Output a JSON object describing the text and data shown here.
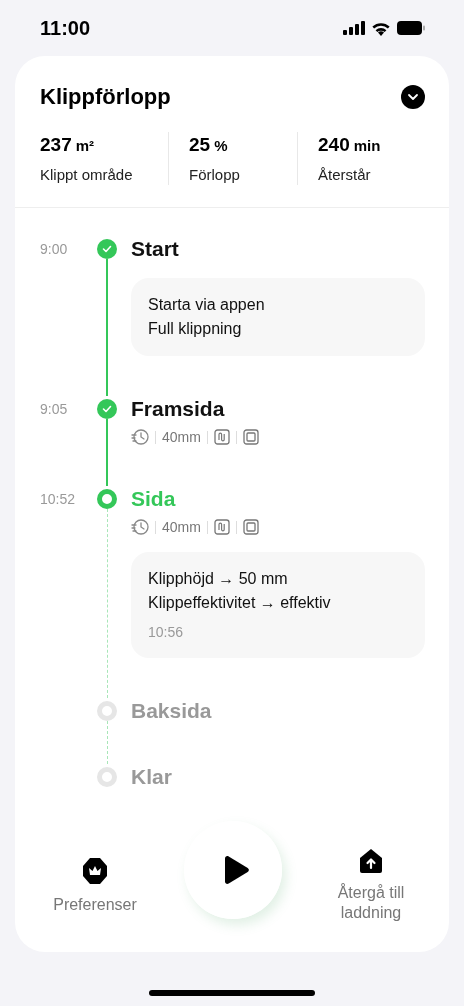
{
  "status_bar": {
    "time": "11:00"
  },
  "header": {
    "title": "Klippförlopp",
    "expanded": false
  },
  "stats": [
    {
      "value": "237",
      "unit": "m²",
      "label": "Klippt område"
    },
    {
      "value": "25",
      "unit": "%",
      "label": "Förlopp"
    },
    {
      "value": "240",
      "unit": "min",
      "label": "Återstår"
    }
  ],
  "steps": [
    {
      "time": "9:00",
      "title": "Start",
      "completed": true,
      "current": false,
      "note": {
        "lines": [
          "Starta via appen",
          "Full klippning"
        ]
      }
    },
    {
      "time": "9:05",
      "title": "Framsida",
      "completed": true,
      "current": false,
      "meta": {
        "height": "40mm"
      }
    },
    {
      "time": "10:52",
      "title": "Sida",
      "completed": false,
      "current": true,
      "meta": {
        "height": "40mm"
      },
      "note": {
        "lines": [
          "Klipphöjd → 50 mm",
          "Klippeffektivitet → effektiv"
        ],
        "time": "10:56"
      }
    },
    {
      "title": "Baksida",
      "completed": false,
      "current": false
    },
    {
      "title": "Klar",
      "completed": false,
      "current": false
    }
  ],
  "footer": {
    "left": "Preferenser",
    "right": "Återgå till laddning"
  }
}
